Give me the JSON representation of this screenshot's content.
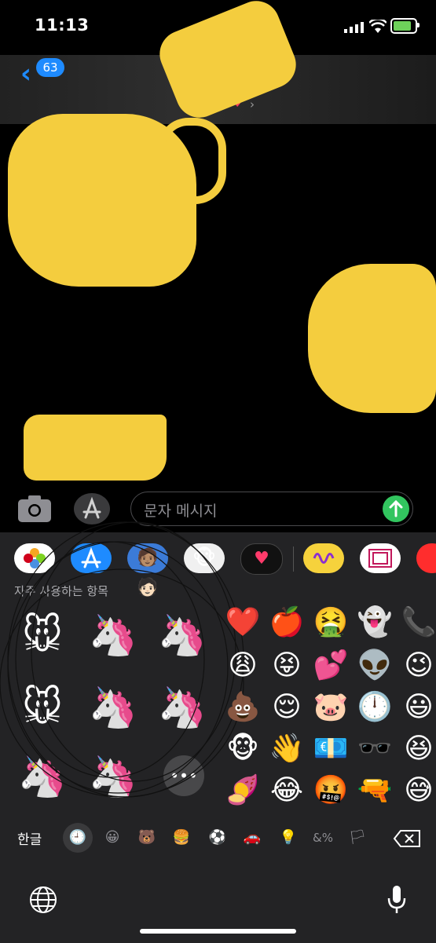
{
  "status_bar": {
    "time": "11:13"
  },
  "nav": {
    "back_count": "63"
  },
  "composer": {
    "placeholder": "문자 메시지"
  },
  "keyboard": {
    "section_label": "자주 사용하는 항목",
    "language_key": "한글",
    "more_label": "•••",
    "memoji_grid": [
      "🐭",
      "🦄",
      "🦄",
      "🐭",
      "🦄",
      "🦄",
      "🦄",
      "🦄"
    ],
    "emoji_grid": [
      [
        "❤️",
        "🍎",
        "🤮",
        "👻",
        "📞"
      ],
      [
        "😩",
        "😝",
        "💕",
        "👽",
        "😉"
      ],
      [
        "💩",
        "😌",
        "🐷",
        "🕛",
        "😃"
      ],
      [
        "🐵",
        "👋",
        "💶",
        "🕶️",
        "😆"
      ],
      [
        "🍠",
        "😂",
        "🤬",
        "🔫",
        "😅"
      ]
    ],
    "category_tabs": [
      "🕘",
      "😀",
      "🐻",
      "🍔",
      "⚽",
      "🚗",
      "💡",
      "&%",
      "🏳"
    ]
  },
  "colors": {
    "accent_blue": "#1e8bff",
    "send_green": "#32c55f",
    "redaction_yellow": "#f4cd3e"
  }
}
